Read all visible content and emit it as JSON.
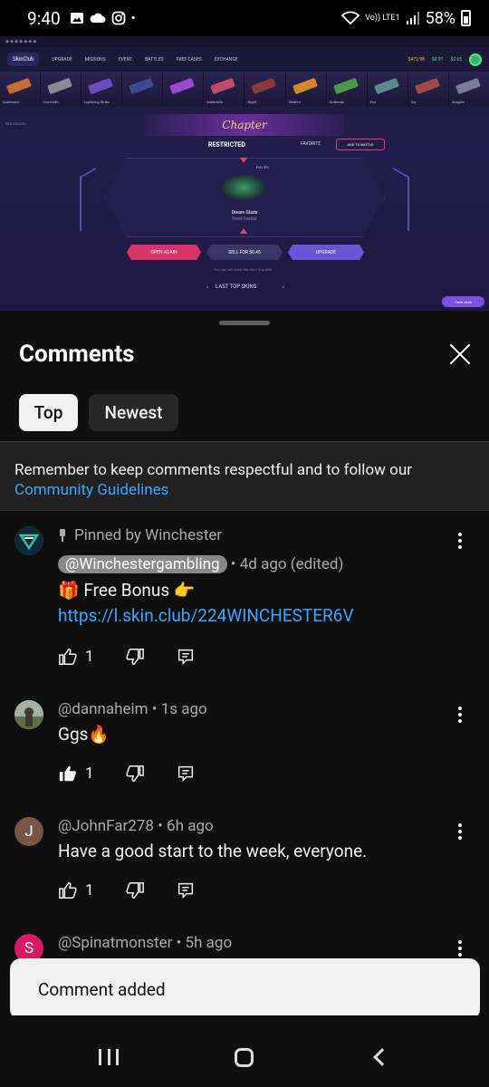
{
  "status_bar": {
    "time": "9:40",
    "network_label": "Vo)) LTE1",
    "battery": "58%"
  },
  "video": {
    "site_name": "SkinClub",
    "nav_items": [
      "UPGRADE",
      "MISSIONS",
      "EVENT",
      "BATTLES",
      "FREE CASES",
      "EXCHANGE"
    ],
    "balance_1": "$472.98",
    "balance_2": "$0.91",
    "balance_3": "$2.65",
    "chapter_banner": "Chapter",
    "breadcrumb": "RESTRICTED",
    "case_status": "RESTRICTED",
    "favorite_label": "FAVORITE",
    "add_to_battle_label": "ADD TO BATTLE",
    "item_price_small": "₽41.5%",
    "item_name": "Dream Glade",
    "item_wear": "Field-Tested",
    "open_again_label": "OPEN AGAIN",
    "sell_label": "SELL FOR $0.45",
    "upgrade_label": "UPGRADE",
    "withdraw_note": "You can withdraw this item in profile",
    "last_top_skins": "LAST TOP SKINS",
    "cashout_label": "Cash desk",
    "strip_items": [
      "Autotronic",
      "Gut Knife",
      "Lightning Strike",
      "",
      "",
      "Malachite",
      "Night",
      "Wildfire",
      "Outbreak",
      "Eco",
      "Ion",
      "Imagine"
    ]
  },
  "comments_sheet": {
    "title": "Comments",
    "tabs": [
      {
        "label": "Top",
        "selected": true
      },
      {
        "label": "Newest",
        "selected": false
      }
    ],
    "notice_text": "Remember to keep comments respectful and to follow our",
    "notice_link": "Community Guidelines",
    "comments": [
      {
        "pinned_label": "Pinned by Winchester",
        "author": "@Winchestergambling",
        "meta": "• 4d ago (edited)",
        "text_line1": "🎁 Free Bonus 👉",
        "link": "https://l.skin.club/224WINCHESTER6V",
        "likes": "1",
        "avatar_color": "#1a3a4a"
      },
      {
        "author": "@dannaheim",
        "meta": "• 1s ago",
        "text": "Ggs🔥",
        "likes": "1",
        "avatar_color": "#6d7a66"
      },
      {
        "author": "@JohnFar278",
        "meta": "• 6h ago",
        "text": "Have a good start to the week, everyone.",
        "likes": "1",
        "avatar_letter": "J",
        "avatar_color": "#795548"
      },
      {
        "author": "@Spinatmonster",
        "meta": "• 5h ago",
        "avatar_letter": "S",
        "avatar_color": "#d81b60"
      }
    ]
  },
  "toast": {
    "text": "Comment added"
  }
}
